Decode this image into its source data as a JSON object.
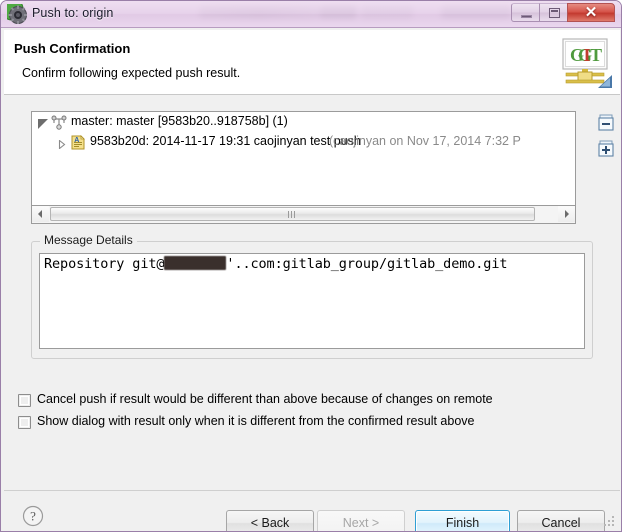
{
  "window": {
    "title": "Push to: origin",
    "icon": "gear-icon",
    "buttons": {
      "minimize": "minimize-icon",
      "maximize": "maximize-icon",
      "close": "✕"
    }
  },
  "header": {
    "title": "Push Confirmation",
    "subtitle": "Confirm following expected push result.",
    "banner_icon": "git-banner-icon",
    "banner_text": {
      "g": "G",
      "i": "I",
      "t": "T"
    }
  },
  "result_tree": {
    "rows": [
      {
        "indent": 0,
        "expanded": true,
        "icon": "branch-icon",
        "label": "master: master [9583b20..918758b] (1)",
        "suffix": ""
      },
      {
        "indent": 1,
        "expanded": false,
        "icon": "commit-note-icon",
        "label": "9583b20d: 2014-11-17 19:31 caojinyan test push",
        "suffix": "(caojinyan on Nov 17, 2014 7:32 P"
      }
    ],
    "side_buttons": {
      "collapse_all": "collapse-all-icon",
      "expand_all": "expand-all-icon"
    },
    "scrollbar": {
      "left_arrow": "◄",
      "right_arrow": "►"
    }
  },
  "message_details": {
    "legend": "Message Details",
    "text_before": "Repository git@",
    "redacted": true,
    "text_after": "'..com:gitlab_group/gitlab_demo.git"
  },
  "options": [
    {
      "id": "cancel-push-if-different",
      "checked": false,
      "label": "Cancel push if result would be different than above because of changes on remote"
    },
    {
      "id": "show-dialog-only-if-different",
      "checked": false,
      "label": "Show dialog with result only when it is different from the confirmed result above"
    }
  ],
  "footer": {
    "help": "?",
    "back": "< Back",
    "next": "Next >",
    "finish": "Finish",
    "cancel": "Cancel",
    "next_enabled": false,
    "finish_is_default": true
  },
  "colors": {
    "titlebar_accent": "#e2cbe6",
    "close_button": "#c33a30",
    "default_button_border": "#2f9fd4",
    "dialog_bg": "#f0f0f0",
    "field_bg": "#ffffff"
  }
}
